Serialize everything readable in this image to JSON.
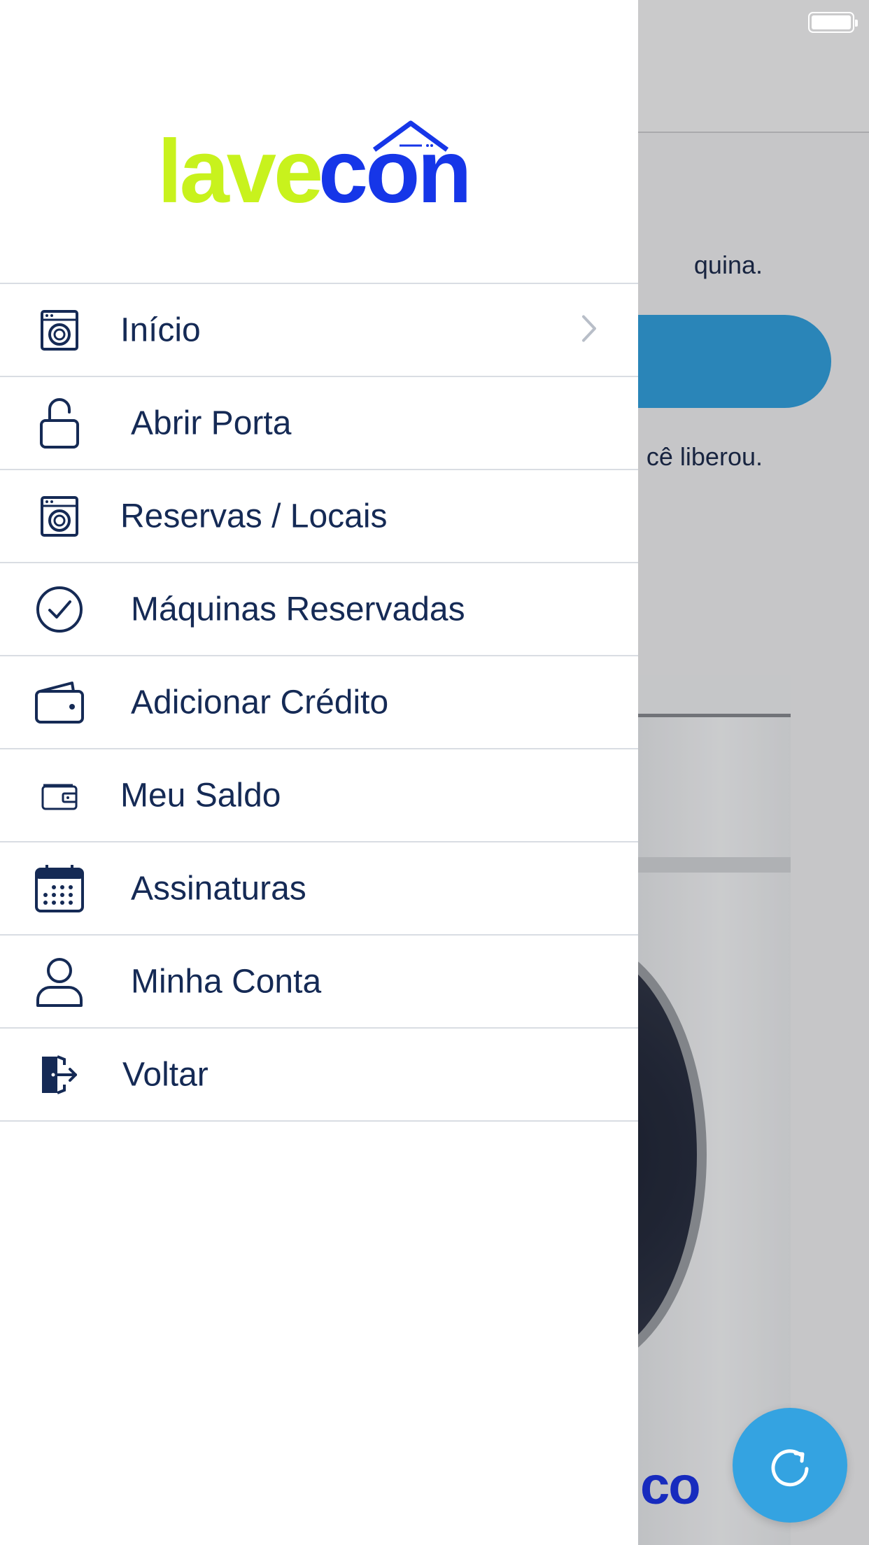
{
  "background": {
    "line1": "quina.",
    "line2": "cê liberou.",
    "machine_logo_text": "co"
  },
  "logo": {
    "part1": "lave",
    "part2": "con"
  },
  "menu": {
    "items": [
      {
        "label": "Início",
        "icon": "washing-machine-icon"
      },
      {
        "label": "Abrir Porta",
        "icon": "unlock-icon"
      },
      {
        "label": "Reservas / Locais",
        "icon": "washing-machine-icon"
      },
      {
        "label": "Máquinas Reservadas",
        "icon": "check-circle-icon"
      },
      {
        "label": "Adicionar Crédito",
        "icon": "wallet-icon"
      },
      {
        "label": "Meu Saldo",
        "icon": "wallet-card-icon"
      },
      {
        "label": "Assinaturas",
        "icon": "calendar-icon"
      },
      {
        "label": "Minha Conta",
        "icon": "user-icon"
      },
      {
        "label": "Voltar",
        "icon": "logout-icon"
      }
    ]
  },
  "colors": {
    "primary_text": "#152a55",
    "accent_blue": "#34a3e1",
    "logo_green": "#c8f21d",
    "logo_blue": "#1636e8"
  }
}
